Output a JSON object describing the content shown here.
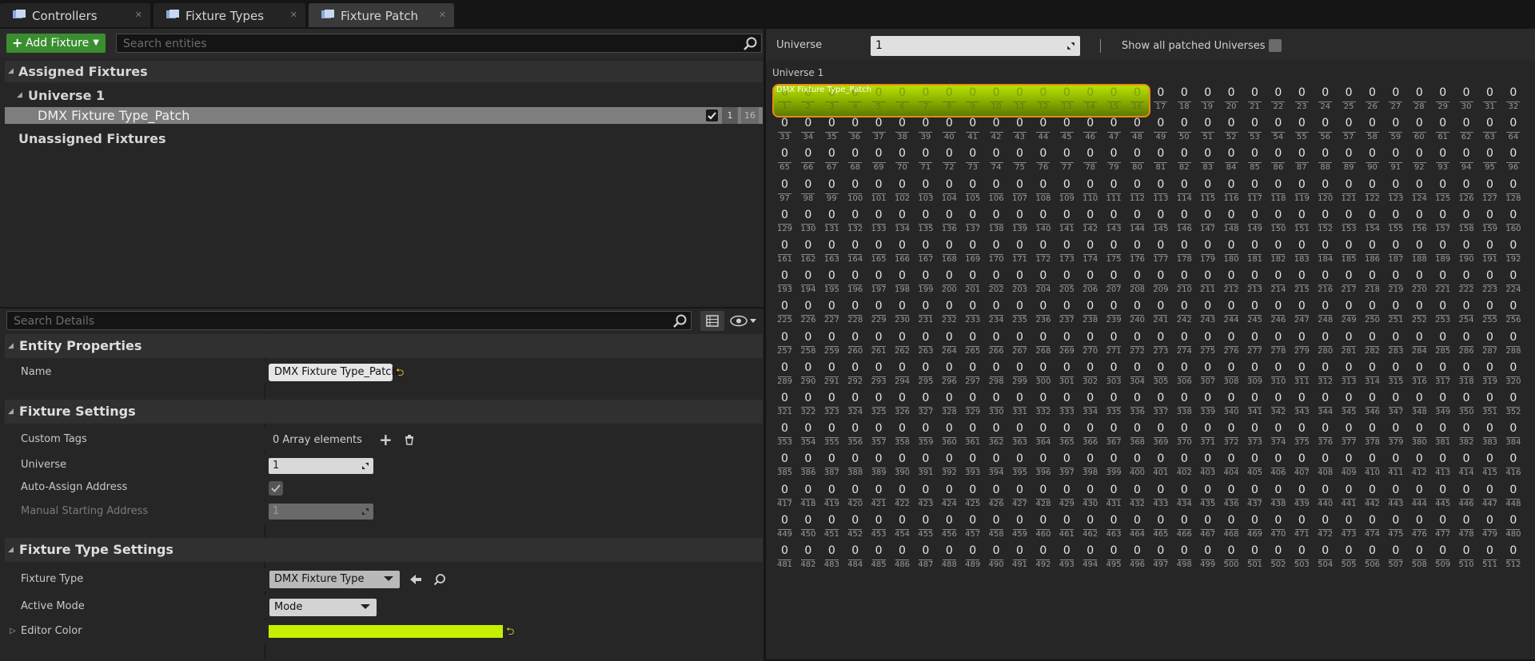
{
  "tabs": [
    {
      "label": "Controllers",
      "active": false
    },
    {
      "label": "Fixture Types",
      "active": false
    },
    {
      "label": "Fixture Patch",
      "active": true
    }
  ],
  "toolbar": {
    "add_fixture_label": "Add Fixture",
    "search_placeholder": "Search entities"
  },
  "tree": {
    "assigned_label": "Assigned Fixtures",
    "universe_label": "Universe 1",
    "fixture_label": "DMX Fixture Type_Patch",
    "fixture_start": "1",
    "fixture_count": "16",
    "unassigned_label": "Unassigned Fixtures"
  },
  "details": {
    "search_placeholder": "Search Details",
    "entity_properties": {
      "title": "Entity Properties",
      "name_label": "Name",
      "name_value": "DMX Fixture Type_Patch"
    },
    "fixture_settings": {
      "title": "Fixture Settings",
      "custom_tags_label": "Custom Tags",
      "custom_tags_value": "0 Array elements",
      "universe_label": "Universe",
      "universe_value": "1",
      "auto_assign_label": "Auto-Assign Address",
      "manual_start_label": "Manual Starting Address",
      "manual_start_value": "1"
    },
    "fixture_type_settings": {
      "title": "Fixture Type Settings",
      "fixture_type_label": "Fixture Type",
      "fixture_type_value": "DMX Fixture Type",
      "active_mode_label": "Active Mode",
      "active_mode_value": "Mode",
      "editor_color_label": "Editor Color",
      "editor_color": "#c4f000"
    }
  },
  "universe_panel": {
    "universe_label": "Universe",
    "universe_value": "1",
    "show_all_label": "Show all patched Universes",
    "grid_title": "Universe 1",
    "patch_label": "DMX Fixture Type_Patch",
    "channel_count": 512,
    "patched_start": 1,
    "patched_end": 16,
    "channel_value": "0"
  },
  "colors": {
    "accent_green": "#c4f000",
    "selection_orange": "#e8891a",
    "add_button": "#3a8e2f"
  }
}
